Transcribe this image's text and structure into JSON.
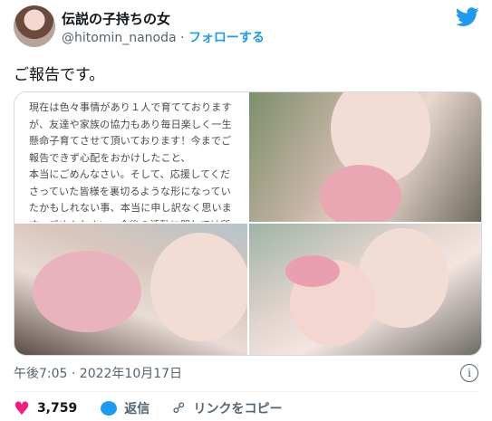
{
  "header": {
    "display_name": "伝説の子持ちの女",
    "handle": "@hitomin_nanoda",
    "separator": "·",
    "follow_label": "フォローする"
  },
  "tweet": {
    "text": "ご報告です。"
  },
  "media": {
    "notice_text": "現在は色々事情があり１人で育てております\nが、友達や家族の協力もあり毎日楽しく一生\n懸命子育てさせて頂いております！今までご\n報告できず心配をおかけしたこと、\n本当にごめんなさい。そして、応援してくだ\nさっていた皆様を裏切るような形になってい\nたかもしれない事、本当に申し訳なく思いま\nす。ごめんなさい。今後の活動に関しては所"
  },
  "meta": {
    "timestamp": "午後7:05 · 2022年10月17日"
  },
  "actions": {
    "like_count": "3,759",
    "reply_label": "返信",
    "copy_link_label": "リンクをコピー"
  },
  "colors": {
    "accent": "#1d9bf0",
    "like": "#f91880",
    "muted": "#536471"
  },
  "icons": {
    "brand": "twitter-bird-icon",
    "like": "heart-icon",
    "reply": "speech-bubble-icon",
    "copy": "link-icon",
    "info": "info-icon"
  }
}
